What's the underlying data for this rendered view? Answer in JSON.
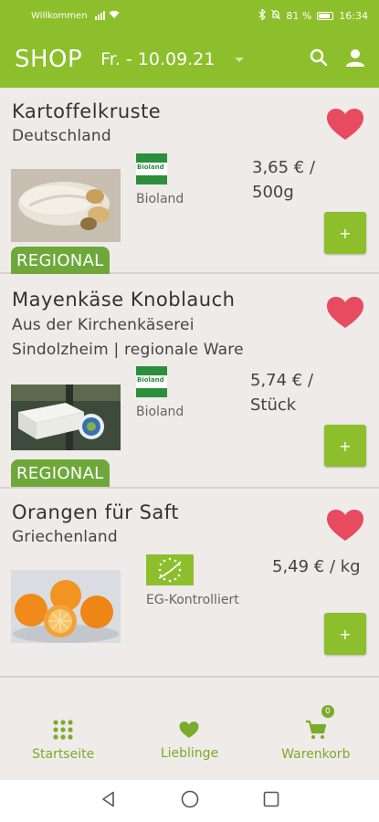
{
  "status_bar": {
    "carrier": "Willkommen",
    "battery_percent": "81 %",
    "time": "16:34"
  },
  "app_bar": {
    "title": "SHOP",
    "date": "Fr. - 10.09.21"
  },
  "products": [
    {
      "name": "Kartoffelkruste",
      "origin_lines": [
        "Deutschland"
      ],
      "certification": "Bioland",
      "price_lines": [
        "3,65 € /",
        "500g"
      ],
      "badge": "REGIONAL",
      "favorite": true,
      "add_label": "+"
    },
    {
      "name": "Mayenkäse Knoblauch",
      "origin_lines": [
        "Aus der Kirchenkäserei",
        "Sindolzheim | regionale Ware"
      ],
      "certification": "Bioland",
      "price_lines": [
        "5,74 € /",
        "Stück"
      ],
      "badge": "REGIONAL",
      "favorite": true,
      "add_label": "+"
    },
    {
      "name": "Orangen für Saft",
      "origin_lines": [
        "Griechenland"
      ],
      "certification": "EG-Kontrolliert",
      "price_lines": [
        "5,49 € / kg"
      ],
      "badge": "",
      "favorite": true,
      "add_label": "+"
    }
  ],
  "cert_logos": {
    "bioland_text": "Bioland"
  },
  "bottom_nav": [
    {
      "label": "Startseite",
      "icon": "grid-icon"
    },
    {
      "label": "Lieblinge",
      "icon": "heart-icon"
    },
    {
      "label": "Warenkorb",
      "icon": "cart-icon",
      "badge": "0"
    }
  ],
  "colors": {
    "brand_green": "#8dbf2c",
    "badge_green": "#6ea83a",
    "heart_red": "#e84a5f",
    "background": "#efebe8"
  }
}
